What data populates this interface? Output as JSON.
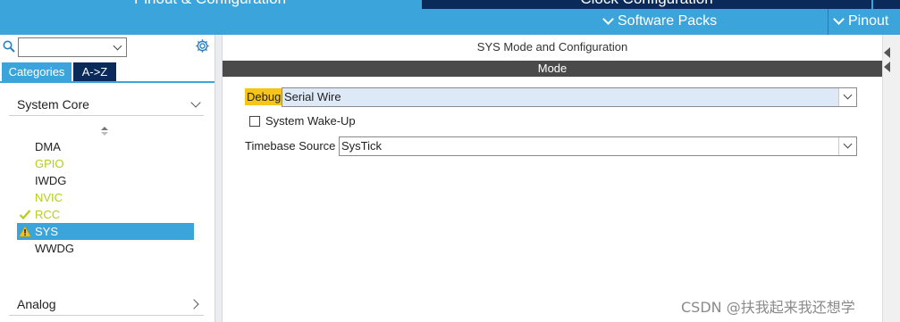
{
  "top_tabs": {
    "pinout_config": "Pinout & Configuration",
    "clock_config": "Clock Configuration"
  },
  "menu": {
    "software_packs": "Software Packs",
    "pinout": "Pinout"
  },
  "left_panel": {
    "search_placeholder": "",
    "tabs": {
      "categories": "Categories",
      "az": "A->Z"
    },
    "categories": [
      {
        "label": "System Core",
        "expanded": true,
        "items": [
          {
            "label": "DMA",
            "status": "none"
          },
          {
            "label": "GPIO",
            "status": "configured"
          },
          {
            "label": "IWDG",
            "status": "none"
          },
          {
            "label": "NVIC",
            "status": "configured"
          },
          {
            "label": "RCC",
            "status": "ok"
          },
          {
            "label": "SYS",
            "status": "warning",
            "selected": true
          },
          {
            "label": "WWDG",
            "status": "none"
          }
        ]
      },
      {
        "label": "Analog",
        "expanded": false
      }
    ]
  },
  "main": {
    "title": "SYS Mode and Configuration",
    "mode_header": "Mode",
    "debug": {
      "label": "Debug",
      "value": "Serial Wire"
    },
    "system_wakeup": {
      "label": "System Wake-Up",
      "checked": false
    },
    "timebase": {
      "label": "Timebase Source",
      "value": "SysTick"
    }
  },
  "watermark": "CSDN @扶我起来我还想学",
  "colors": {
    "accent_blue": "#3ba5db",
    "navy": "#0a2a5a",
    "mode_bar": "#4a4a4a",
    "highlight_yellow": "#f5c518",
    "configured_green": "#b7cc1a"
  }
}
